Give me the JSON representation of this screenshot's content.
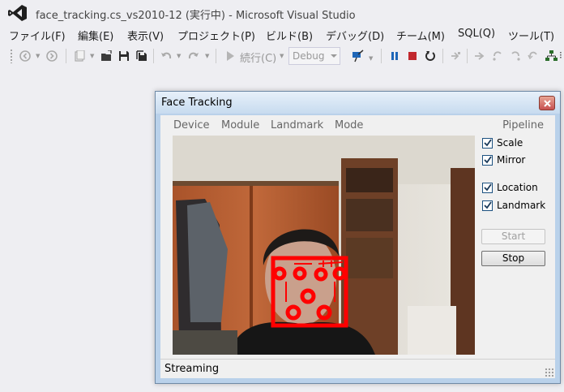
{
  "vs": {
    "title": "face_tracking.cs_vs2010-12 (実行中) - Microsoft Visual Studio",
    "menu": [
      {
        "key": "file",
        "label": "ファイル(F)"
      },
      {
        "key": "edit",
        "label": "編集(E)"
      },
      {
        "key": "view",
        "label": "表示(V)"
      },
      {
        "key": "project",
        "label": "プロジェクト(P)"
      },
      {
        "key": "build",
        "label": "ビルド(B)"
      },
      {
        "key": "debug",
        "label": "デバッグ(D)"
      },
      {
        "key": "team",
        "label": "チーム(M)"
      },
      {
        "key": "sql",
        "label": "SQL(Q)"
      },
      {
        "key": "tools",
        "label": "ツール(T)"
      }
    ],
    "toolbar": {
      "continue_label": "続行(C)",
      "configuration": "Debug"
    },
    "colors": {
      "logo": "#68217a",
      "pause": "#1e66b8",
      "stop": "#c1272d",
      "overlay": "#ff0000"
    }
  },
  "face_tracking": {
    "title": "Face Tracking",
    "menu": {
      "device": "Device",
      "module": "Module",
      "landmark": "Landmark",
      "mode": "Mode",
      "pipeline": "Pipeline"
    },
    "options": {
      "scale": {
        "label": "Scale",
        "checked": true
      },
      "mirror": {
        "label": "Mirror",
        "checked": true
      },
      "location": {
        "label": "Location",
        "checked": true
      },
      "landmark": {
        "label": "Landmark",
        "checked": true
      }
    },
    "buttons": {
      "start": "Start",
      "stop": "Stop"
    },
    "status": "Streaming"
  }
}
